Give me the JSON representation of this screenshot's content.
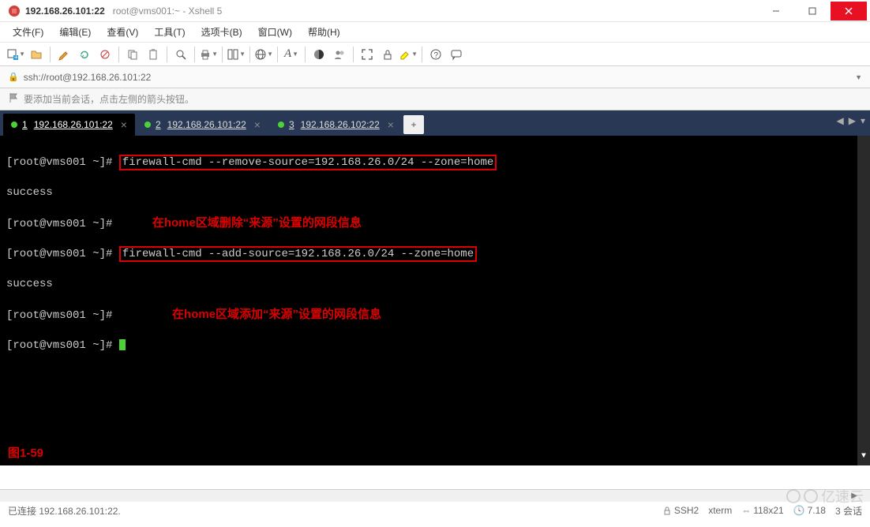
{
  "window": {
    "title_main": "192.168.26.101:22",
    "title_sub": "root@vms001:~ - Xshell 5"
  },
  "menu": {
    "file": "文件(F)",
    "edit": "编辑(E)",
    "view": "查看(V)",
    "tools": "工具(T)",
    "tabs": "选项卡(B)",
    "window": "窗口(W)",
    "help": "帮助(H)"
  },
  "addressbar": {
    "url": "ssh://root@192.168.26.101:22"
  },
  "hint": {
    "text": "要添加当前会话，点击左侧的箭头按钮。"
  },
  "tabs": [
    {
      "num": "1",
      "label": "192.168.26.101:22",
      "active": true
    },
    {
      "num": "2",
      "label": "192.168.26.101:22",
      "active": false
    },
    {
      "num": "3",
      "label": "192.168.26.102:22",
      "active": false
    }
  ],
  "terminal": {
    "prompt": "[root@vms001 ~]# ",
    "cmd1": "firewall-cmd --remove-source=192.168.26.0/24 --zone=home",
    "out1": "success",
    "anno1": "在home区域删除“来源”设置的网段信息",
    "cmd2": "firewall-cmd --add-source=192.168.26.0/24 --zone=home",
    "out2": "success",
    "anno2": "在home区域添加“来源”设置的网段信息",
    "figure_label": "图1-59"
  },
  "status": {
    "connected": "已连接 192.168.26.101:22.",
    "proto": "SSH2",
    "term": "xterm",
    "size": "118x21",
    "rows_unit_prefix": "",
    "load": "7.18",
    "sessions": "3 会话"
  },
  "icons": {
    "new": "new-tab-icon",
    "open": "open-icon",
    "pencil": "edit-icon",
    "copy": "copy-icon",
    "paste": "paste-icon",
    "find": "find-icon"
  },
  "watermark": "亿速云"
}
